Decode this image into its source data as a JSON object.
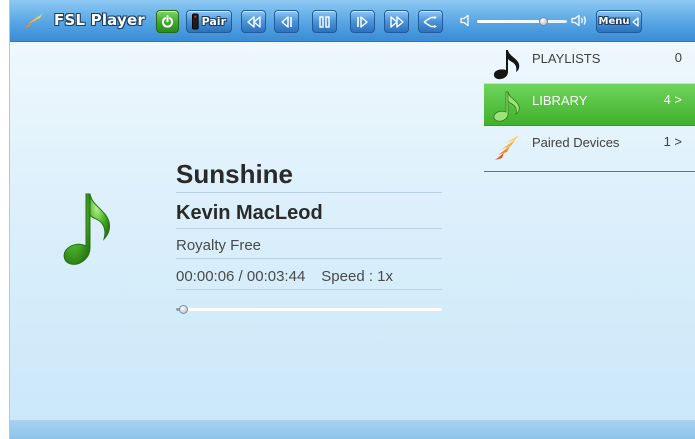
{
  "app": {
    "title": "FSL Player"
  },
  "toolbar": {
    "pair_label": "Pair",
    "menu_label": "Menu",
    "volume_level": 0.73,
    "icons": [
      "power-icon",
      "pair-remote-icon",
      "rewind-icon",
      "previous-track-icon",
      "pause-icon",
      "next-track-icon",
      "fast-forward-icon",
      "shuffle-icon",
      "volume-low-icon",
      "volume-high-icon",
      "menu-arrow-icon"
    ]
  },
  "now_playing": {
    "title": "Sunshine",
    "artist": "Kevin MacLeod",
    "album": "Royalty Free",
    "position": "00:00:06",
    "duration": "00:03:44",
    "time_display": "00:00:06 / 00:03:44",
    "speed_label": "Speed : 1x",
    "progress_fraction": 0.027
  },
  "sidebar": {
    "items": [
      {
        "label": "PLAYLISTS",
        "count": "0",
        "icon": "music-note-icon",
        "selected": false
      },
      {
        "label": "LIBRARY",
        "count": "4 >",
        "icon": "music-note-icon",
        "selected": true
      },
      {
        "label": "Paired Devices",
        "count": "1 >",
        "icon": "paired-devices-icon",
        "selected": false
      }
    ]
  },
  "colors": {
    "toolbar_blue": "#4a93d8",
    "selected_green": "#40b02c",
    "background_light_blue": "#ddf0fb"
  }
}
